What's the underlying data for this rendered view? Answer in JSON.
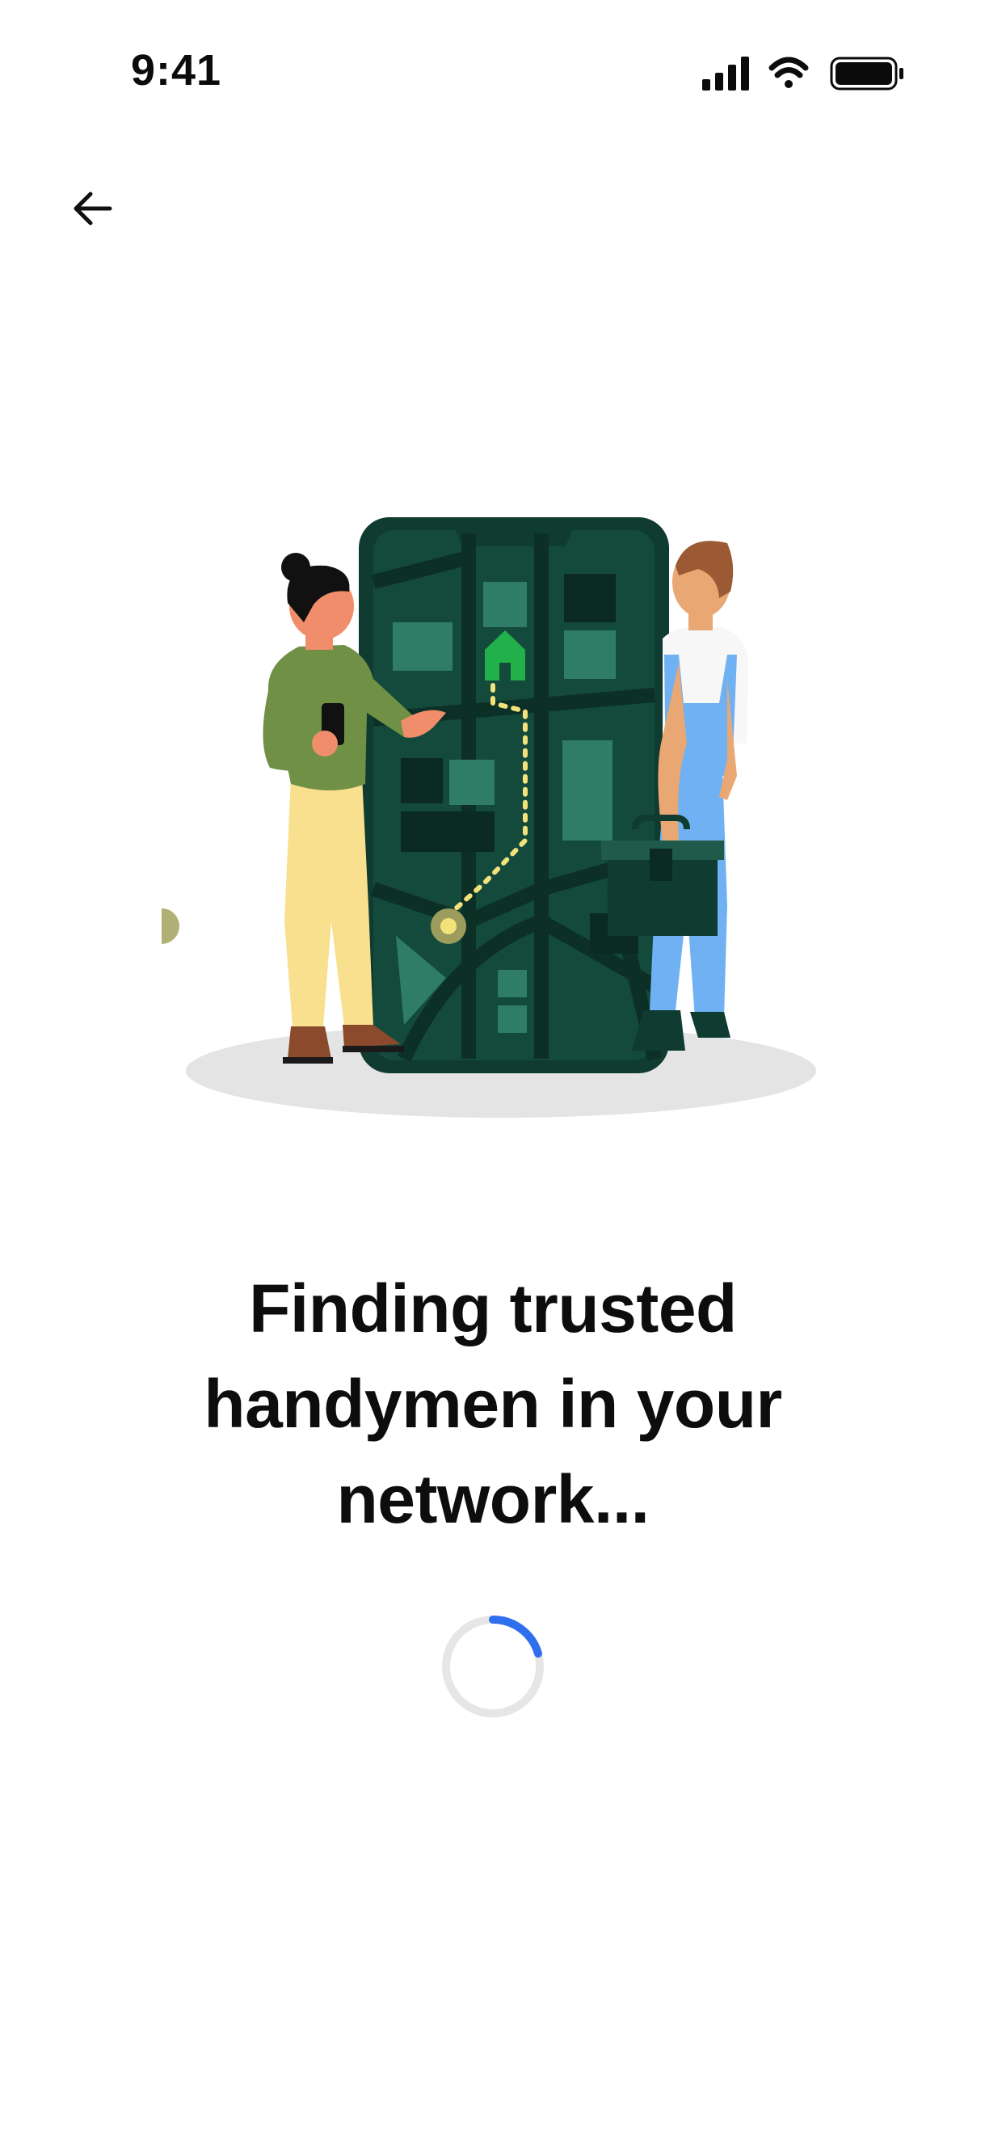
{
  "status_bar": {
    "time": "9:41",
    "icons": [
      "cellular-signal-icon",
      "wifi-icon",
      "battery-icon"
    ]
  },
  "navigation": {
    "back_icon": "arrow-left-icon"
  },
  "illustration": {
    "icon": "handyman-map-illustration"
  },
  "main": {
    "headline": "Finding trusted handymen in your network..."
  },
  "loading": {
    "icon": "loading-spinner-icon",
    "accent_color": "#2f6fef",
    "track_color": "#e6e6e6"
  },
  "colors": {
    "background": "#ffffff",
    "text": "#0d0d0d",
    "phone_dark": "#0f3b30",
    "map_block": "#2f7d66",
    "home_pin": "#22b04b"
  }
}
